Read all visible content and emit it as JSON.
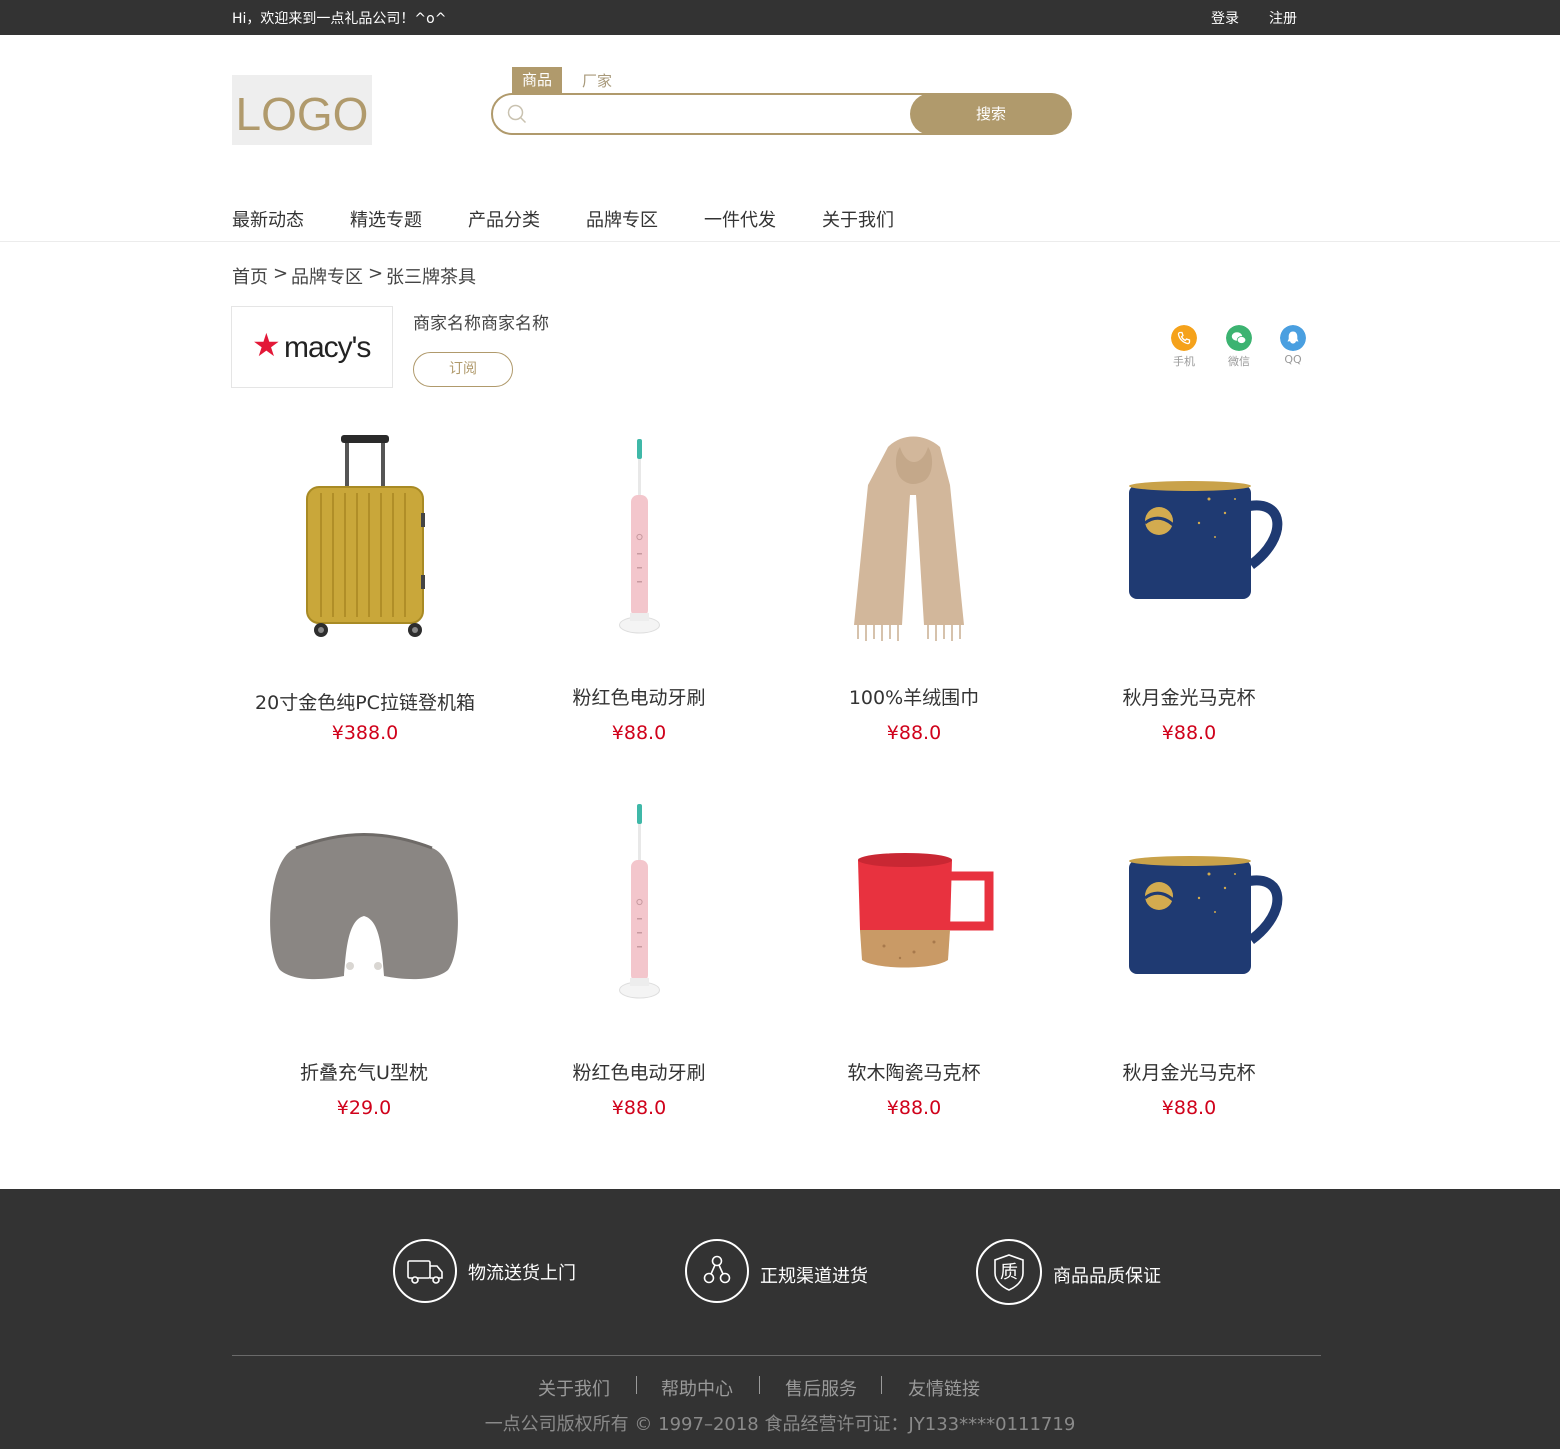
{
  "topbar": {
    "greeting": "Hi，欢迎来到一点礼品公司！^o^",
    "login": "登录",
    "register": "注册"
  },
  "header": {
    "logo_text": "LOGO",
    "search_tabs": [
      "商品",
      "厂家"
    ],
    "search_placeholder": "",
    "search_button": "搜索"
  },
  "nav": [
    "最新动态",
    "精选专题",
    "产品分类",
    "品牌专区",
    "一件代发",
    "关于我们"
  ],
  "breadcrumb": [
    "首页",
    "品牌专区",
    "张三牌茶具"
  ],
  "breadcrumb_sep": ">",
  "merchant": {
    "logo_text": "macy's",
    "name": "商家名称商家名称",
    "subscribe": "订阅",
    "contacts": [
      {
        "label": "手机",
        "icon": "phone-icon",
        "color": "#f5a21b"
      },
      {
        "label": "微信",
        "icon": "wechat-icon",
        "color": "#3cb371"
      },
      {
        "label": "QQ",
        "icon": "qq-icon",
        "color": "#4a9fe0"
      }
    ]
  },
  "products": [
    {
      "name": "20寸金色纯PC拉链登机箱",
      "price": "¥388.0",
      "image": "gold-suitcase"
    },
    {
      "name": "粉红色电动牙刷",
      "price": "¥88.0",
      "image": "pink-toothbrush"
    },
    {
      "name": "100%羊绒围巾",
      "price": "¥88.0",
      "image": "beige-scarf"
    },
    {
      "name": "秋月金光马克杯",
      "price": "¥88.0",
      "image": "blue-mug"
    },
    {
      "name": "折叠充气U型枕",
      "price": "¥29.0",
      "image": "grey-neck-pillow"
    },
    {
      "name": "粉红色电动牙刷",
      "price": "¥88.0",
      "image": "pink-toothbrush"
    },
    {
      "name": "软木陶瓷马克杯",
      "price": "¥88.0",
      "image": "red-cork-mug"
    },
    {
      "name": "秋月金光马克杯",
      "price": "¥88.0",
      "image": "blue-mug"
    }
  ],
  "footer": {
    "features": [
      {
        "label": "物流送货上门",
        "icon": "truck-icon"
      },
      {
        "label": "正规渠道进货",
        "icon": "network-icon"
      },
      {
        "label": "商品品质保证",
        "icon": "quality-icon"
      }
    ],
    "quality_glyph": "质",
    "links": [
      "关于我们",
      "帮助中心",
      "售后服务",
      "友情链接"
    ],
    "copyright": "一点公司版权所有 © 1997–2018    食品经营许可证：JY133****0111719"
  }
}
